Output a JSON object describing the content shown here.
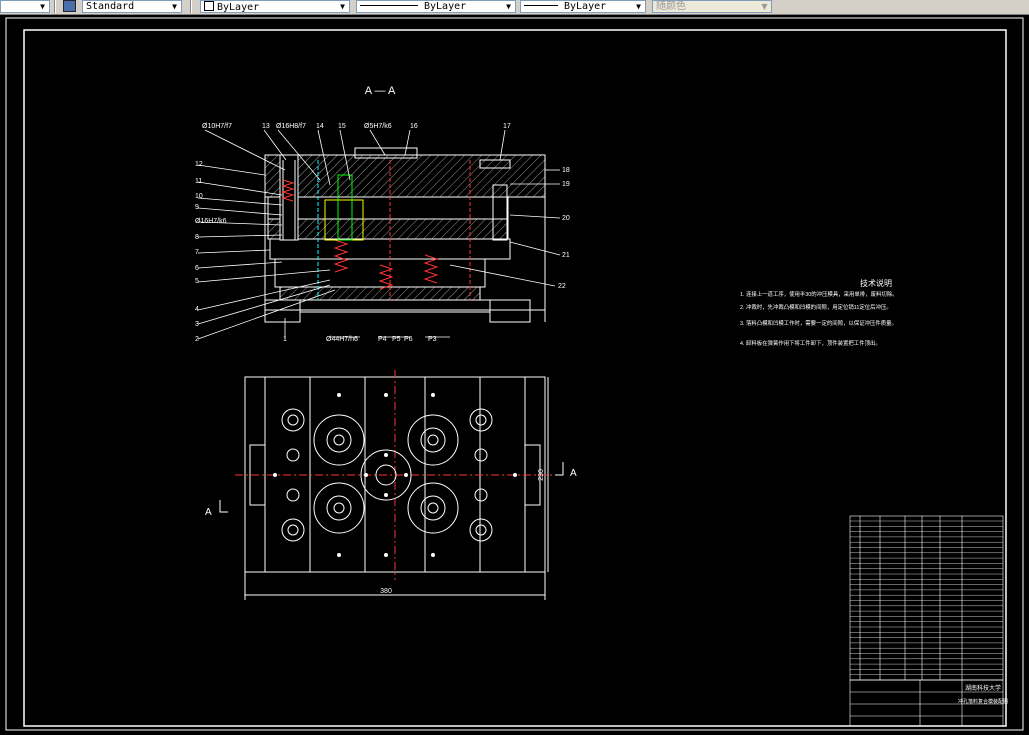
{
  "toolbar": {
    "textstyle": "Standard",
    "layer": "ByLayer",
    "linetype": "ByLayer",
    "lineweight": "ByLayer",
    "color": "随颜色"
  },
  "drawing": {
    "section_title": "A — A",
    "section_mark": "A",
    "callouts_top": [
      "Ø10H7/f7",
      "13",
      "Ø16H8/f7",
      "14",
      "15",
      "Ø5H7/k6",
      "16",
      "17"
    ],
    "callouts_left": [
      "12",
      "11",
      "10",
      "9",
      "Ø16H7/k6",
      "8",
      "7",
      "6",
      "5",
      "4",
      "3",
      "2",
      "1"
    ],
    "callouts_right": [
      "18",
      "19",
      "20",
      "21",
      "22"
    ],
    "callouts_bottom": [
      "Ø44H7/h6",
      "P4",
      "P5",
      "P6",
      "P3"
    ],
    "dim_width": "380",
    "dim_height": "230",
    "tech_title": "技术说明",
    "tech_lines": [
      "1. 连接上一道工序，使用半30的冲压模具，采用单排，废料切除。",
      "2. 冲裁时，先冲裁凸模和凹模的间隙，用定位销11定位后冲压。",
      "3. 落料凸模和凹模工作时，需要一定的间隙，以保证冲压件质量。",
      "4. 卸料板在弹簧作用下将工件卸下，顶件装置把工件顶出。"
    ],
    "title_block": {
      "school": "湖南科技大学",
      "drawing_name": "冲孔落料复合模装配图"
    }
  }
}
